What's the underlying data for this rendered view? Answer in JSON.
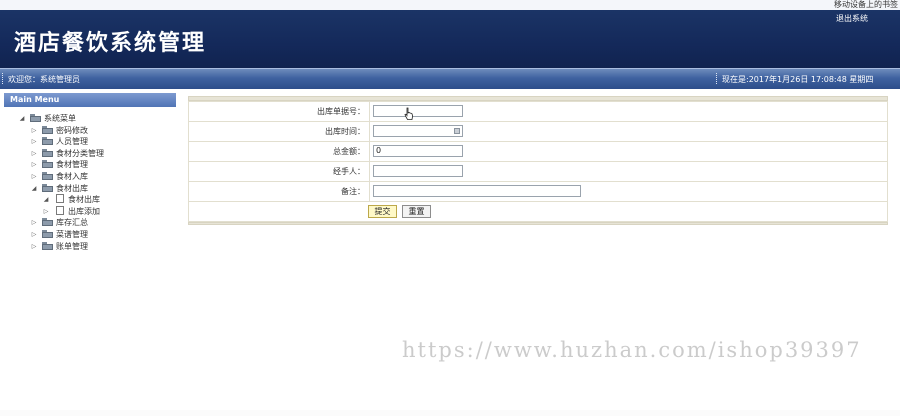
{
  "topbar": {
    "link": "移动设备上的书签"
  },
  "header": {
    "title": "酒店餐饮系统管理",
    "logout": "退出系统"
  },
  "welcome_bar": {
    "welcome": "欢迎您：系统管理员",
    "datetime": "现在是:2017年1月26日 17:08:48 星期四"
  },
  "sidebar": {
    "heading": "Main Menu",
    "root": "系统菜单",
    "items": [
      {
        "label": "密码修改",
        "expanded": false
      },
      {
        "label": "人员管理",
        "expanded": false
      },
      {
        "label": "食材分类管理",
        "expanded": false
      },
      {
        "label": "食材管理",
        "expanded": false
      },
      {
        "label": "食材入库",
        "expanded": false
      },
      {
        "label": "食材出库",
        "expanded": true,
        "children": [
          "食材出库",
          "出库添加"
        ]
      },
      {
        "label": "库存汇总",
        "expanded": false
      },
      {
        "label": "菜谱管理",
        "expanded": false
      },
      {
        "label": "账单管理",
        "expanded": false
      }
    ]
  },
  "form": {
    "fields": [
      {
        "label": "出库单据号：",
        "value": ""
      },
      {
        "label": "出库时间：",
        "value": ""
      },
      {
        "label": "总金额：",
        "value": "0"
      },
      {
        "label": "经手人：",
        "value": ""
      },
      {
        "label": "备注：",
        "value": ""
      }
    ],
    "submit_label": "提交",
    "reset_label": "重置"
  },
  "watermark": "https://www.huzhan.com/ishop39397",
  "colors": {
    "header_bg": "#14295a",
    "bar_bg": "#3f62a0",
    "submit_bg": "#fff9c7"
  }
}
